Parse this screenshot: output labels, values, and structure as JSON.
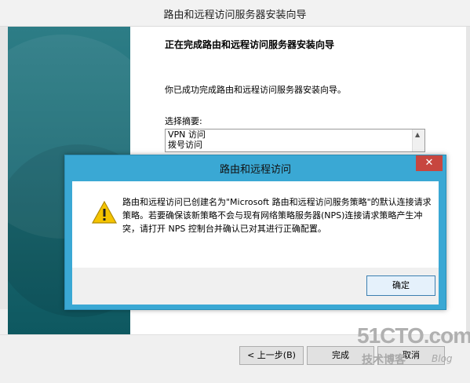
{
  "wizard": {
    "title": "路由和远程访问服务器安装向导",
    "heading": "正在完成路由和远程访问服务器安装向导",
    "text": "你已成功完成路由和远程访问服务器安装向导。",
    "summary_label": "选择摘要:",
    "summary_items": [
      "VPN 访问",
      "拨号访问"
    ],
    "buttons": {
      "back": "< 上一步(B)",
      "finish": "完成",
      "cancel": "取消"
    }
  },
  "dialog": {
    "title": "路由和远程访问",
    "close_label": "✕",
    "message": "路由和远程访问已创建名为\"Microsoft 路由和远程访问服务策略\"的默认连接请求策略。若要确保该新策略不会与现有网络策略服务器(NPS)连接请求策略产生冲突，请打开 NPS 控制台并确认已对其进行正确配置。",
    "ok_label": "确定"
  },
  "watermark": {
    "main": "51CTO.com",
    "sub": "技术博客",
    "blog": "Blog"
  },
  "colors": {
    "banner": "#1f6e78",
    "dialog_frame": "#3aa8d4",
    "close_button": "#c7463f"
  }
}
